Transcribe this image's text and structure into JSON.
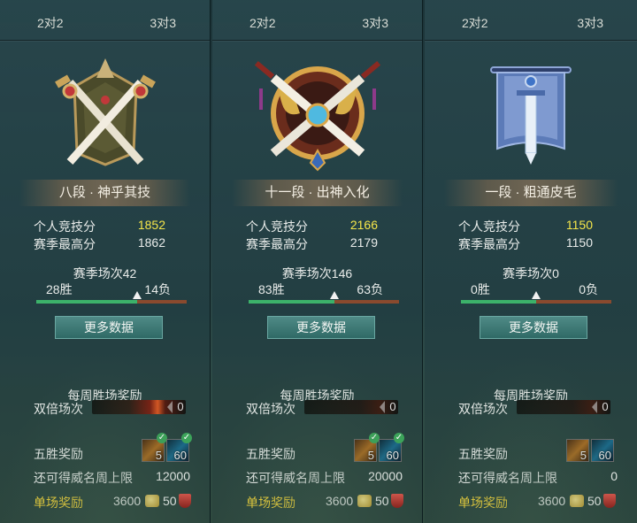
{
  "panels": [
    {
      "tabs": [
        "2对2",
        "3对3"
      ],
      "rank": "八段 · 神乎其技",
      "emblem_icon": "crossed-swords-banner-emblem-icon",
      "personal_score_label": "个人竞技分",
      "personal_score": "1852",
      "season_best_label": "赛季最高分",
      "season_best": "1862",
      "season_games": "赛季场次42",
      "wins": "28胜",
      "losses": "14负",
      "win_fraction": 0.67,
      "more_button": "更多数据",
      "weekly_reward": "每周胜场奖励",
      "double_label": "双倍场次",
      "double_count": "0",
      "five_win_label": "五胜奖励",
      "item1_count": "5",
      "item2_count": "60",
      "prestige_label": "还可得威名周上限",
      "prestige_value": "12000",
      "single_label": "单场奖励",
      "single_coin": "3600",
      "single_shield": "50"
    },
    {
      "tabs": [
        "2对2",
        "3对3"
      ],
      "rank": "十一段 · 出神入化",
      "emblem_icon": "crossed-swords-dragon-emblem-icon",
      "personal_score_label": "个人竞技分",
      "personal_score": "2166",
      "season_best_label": "赛季最高分",
      "season_best": "2179",
      "season_games": "赛季场次146",
      "wins": "83胜",
      "losses": "63负",
      "win_fraction": 0.57,
      "more_button": "更多数据",
      "weekly_reward": "每周胜场奖励",
      "double_label": "双倍场次",
      "double_count": "0",
      "five_win_label": "五胜奖励",
      "item1_count": "5",
      "item2_count": "60",
      "prestige_label": "还可得威名周上限",
      "prestige_value": "20000",
      "single_label": "单场奖励",
      "single_coin": "3600",
      "single_shield": "50"
    },
    {
      "tabs": [
        "2对2",
        "3对3"
      ],
      "rank": "一段 · 粗通皮毛",
      "emblem_icon": "sword-banner-emblem-icon",
      "personal_score_label": "个人竞技分",
      "personal_score": "1150",
      "season_best_label": "赛季最高分",
      "season_best": "1150",
      "season_games": "赛季场次0",
      "wins": "0胜",
      "losses": "0负",
      "win_fraction": 0.5,
      "more_button": "更多数据",
      "weekly_reward": "每周胜场奖励",
      "double_label": "双倍场次",
      "double_count": "0",
      "five_win_label": "五胜奖励",
      "item1_count": "5",
      "item2_count": "60",
      "prestige_label": "还可得威名周上限",
      "prestige_value": "0",
      "single_label": "单场奖励",
      "single_coin": "3600",
      "single_shield": "50"
    }
  ],
  "colors": {
    "score_highlight": "#f5e64a",
    "single_reward_label": "#f0d23a",
    "win_bar": "#3cb26a",
    "loss_bar": "#8a4a2e"
  }
}
